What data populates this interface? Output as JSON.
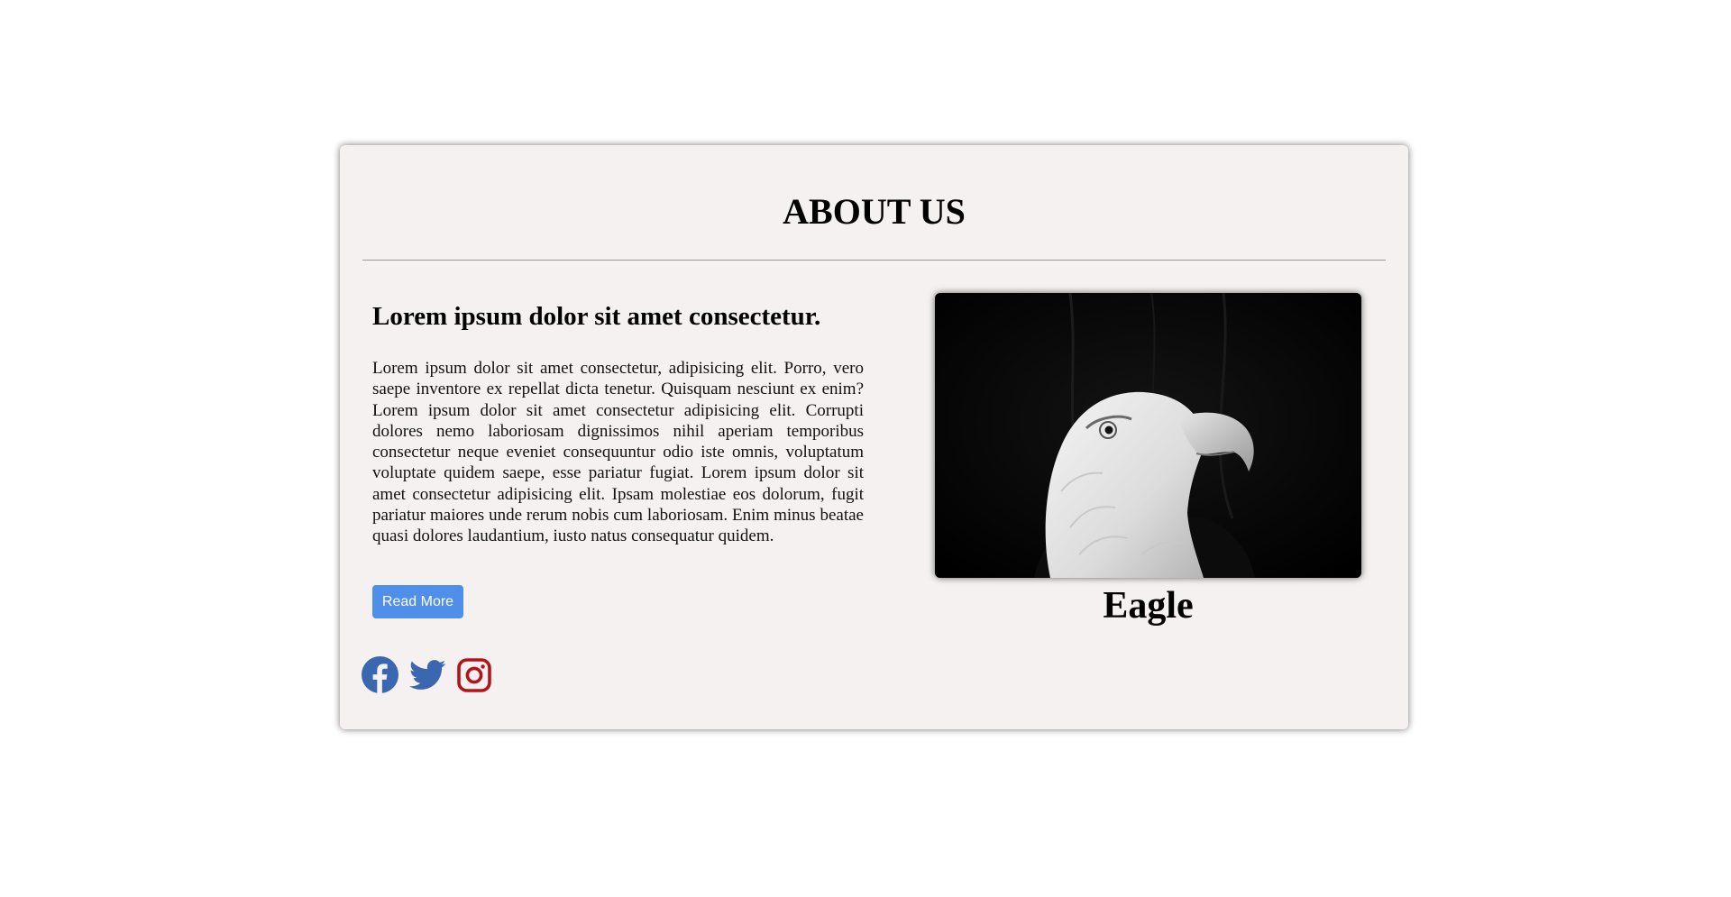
{
  "about": {
    "title": "ABOUT US",
    "heading": "Lorem ipsum dolor sit amet consectetur.",
    "body": "Lorem ipsum dolor sit amet consectetur, adipisicing elit. Porro, vero saepe inventore ex repellat dicta tenetur. Quisquam nesciunt ex enim? Lorem ipsum dolor sit amet consectetur adipisicing elit. Corrupti dolores nemo laboriosam dignissimos nihil aperiam temporibus consectetur neque eveniet consequuntur odio iste omnis, voluptatum voluptate quidem saepe, esse pariatur fugiat. Lorem ipsum dolor sit amet consectetur adipisicing elit. Ipsam molestiae eos dolorum, fugit pariatur maiores unde rerum nobis cum laboriosam. Enim minus beatae quasi dolores laudantium, iusto natus consequatur quidem.",
    "button_label": "Read More",
    "image_caption": "Eagle"
  },
  "social": [
    {
      "name": "facebook",
      "icon": "facebook-icon",
      "color": "#3b66b0"
    },
    {
      "name": "twitter",
      "icon": "twitter-icon",
      "color": "#3b66b0"
    },
    {
      "name": "instagram",
      "icon": "instagram-icon",
      "color": "#b3141b"
    }
  ],
  "colors": {
    "card_background": "#f5f1f0",
    "button_background": "#4f8fea",
    "button_text": "#ffffff"
  }
}
